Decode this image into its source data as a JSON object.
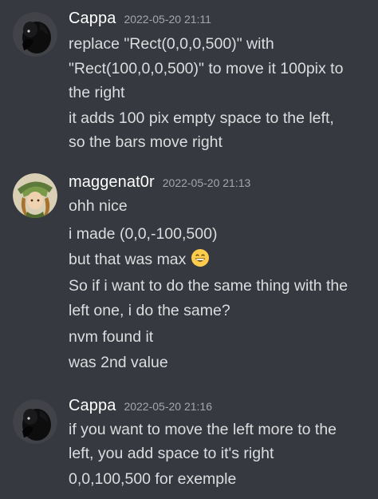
{
  "messages": [
    {
      "username": "Cappa",
      "timestamp": "2022-05-20 21:11",
      "avatar_icon": "black-creature-avatar",
      "lines": [
        "replace \"Rect(0,0,0,500)\" with",
        "\"Rect(100,0,0,500)\" to move it 100pix to",
        "the right",
        "it adds 100 pix empty space to the left,",
        "so the bars move right"
      ]
    },
    {
      "username": "maggenat0r",
      "timestamp": "2022-05-20 21:13",
      "avatar_icon": "cartoon-character-avatar",
      "lines": [
        "ohh nice",
        "i made (0,0,-100,500)",
        "but that was max",
        "So if i want to do the same thing with the",
        "left one, i do the same?",
        "nvm found it",
        "was 2nd value"
      ],
      "emoji": "grinning-face-emoji"
    },
    {
      "username": "Cappa",
      "timestamp": "2022-05-20 21:16",
      "avatar_icon": "black-creature-avatar",
      "lines": [
        "if you want to move the left more to the",
        "left, you add space to it's right",
        "0,0,100,500 for exemple"
      ]
    }
  ],
  "colors": {
    "background": "#36393f",
    "username": "#ffffff",
    "timestamp": "#a3a6aa",
    "text": "#dcddde"
  }
}
